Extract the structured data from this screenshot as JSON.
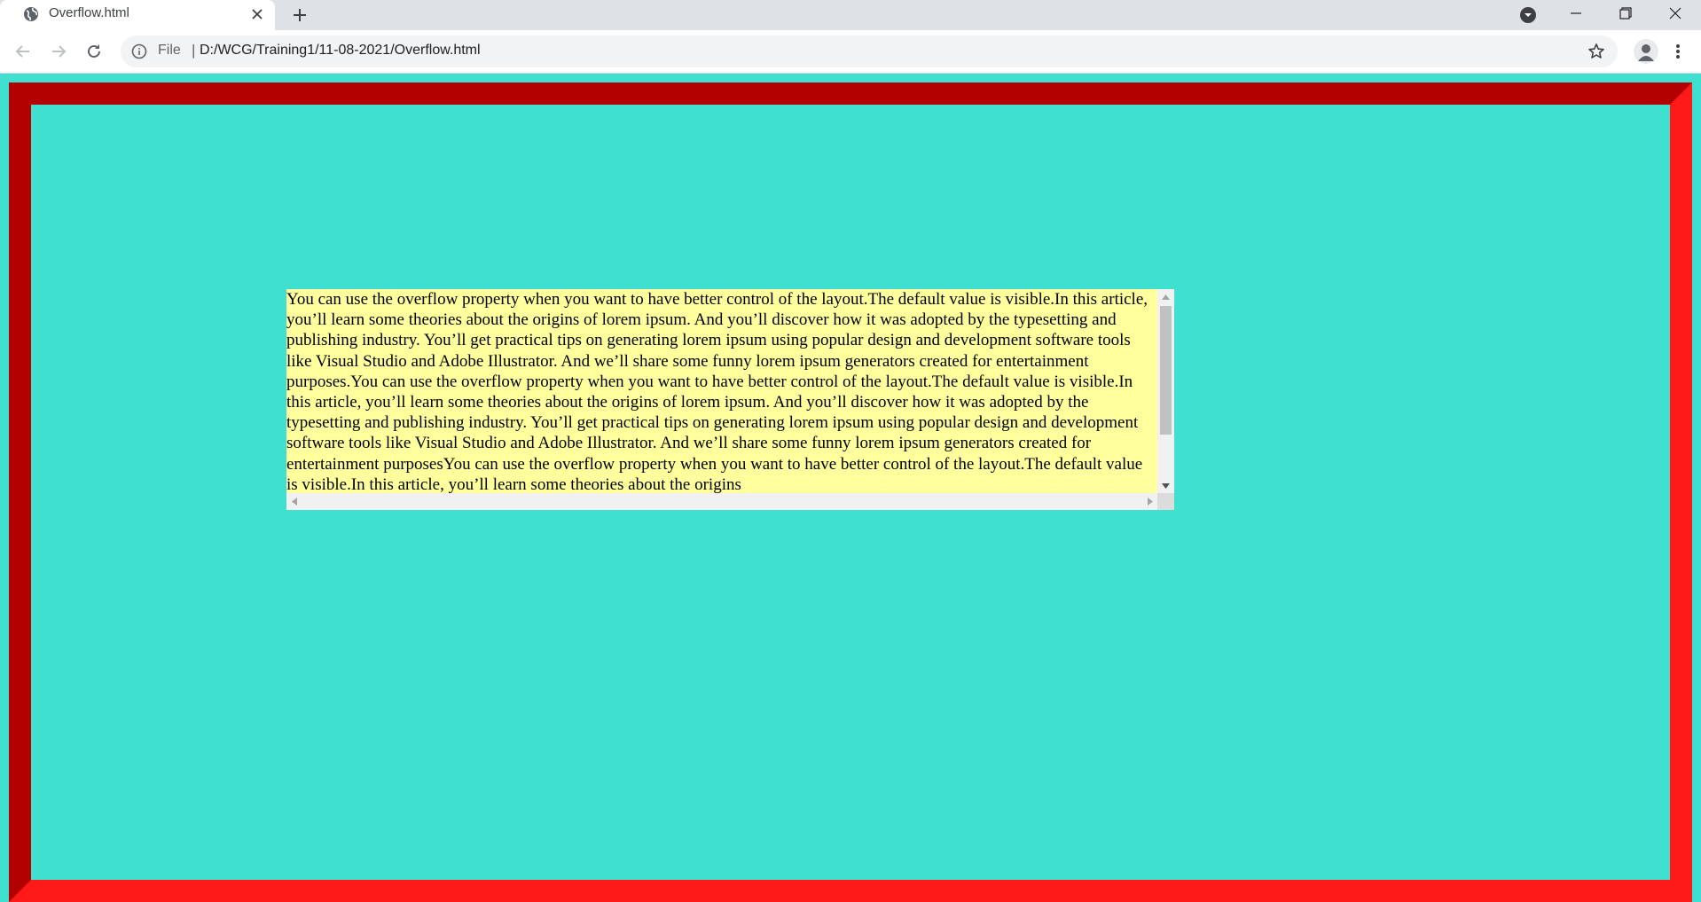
{
  "browser": {
    "tab": {
      "title": "Overflow.html",
      "favicon": "globe-icon",
      "close_icon": "close-icon"
    },
    "new_tab_icon": "plus-icon",
    "tab_search_icon": "chevron-down-circle-icon",
    "window_controls": [
      "minimize-icon",
      "restore-icon",
      "close-icon"
    ],
    "toolbar": {
      "back_icon": "arrow-left-icon",
      "forward_icon": "arrow-right-icon",
      "reload_icon": "reload-icon",
      "site_info_icon": "info-icon",
      "scheme_label": "File",
      "url": "D:/WCG/Training1/11-08-2021/Overflow.html",
      "bookmark_icon": "star-icon",
      "profile_icon": "person-icon",
      "menu_icon": "kebab-menu-icon"
    }
  },
  "page": {
    "background_color": "#40e0d0",
    "frame_border_color": "#ff1a1a",
    "box_background_color": "#ffff9e",
    "overflow_text": "You can use the overflow property when you want to have better control of the layout.The default value is visible.In this article, you’ll learn some theories about the origins of lorem ipsum. And you’ll discover how it was adopted by the typesetting and publishing industry. You’ll get practical tips on generating lorem ipsum using popular design and development software tools like Visual Studio and Adobe Illustrator. And we’ll share some funny lorem ipsum generators created for entertainment purposes.You can use the overflow property when you want to have better control of the layout.The default value is visible.In this article, you’ll learn some theories about the origins of lorem ipsum. And you’ll discover how it was adopted by the typesetting and publishing industry. You’ll get practical tips on generating lorem ipsum using popular design and development software tools like Visual Studio and Adobe Illustrator. And we’ll share some funny lorem ipsum generators created for entertainment purposesYou can use the overflow property when you want to have better control of the layout.The default value is visible.In this article, you’ll learn some theories about the origins"
  }
}
